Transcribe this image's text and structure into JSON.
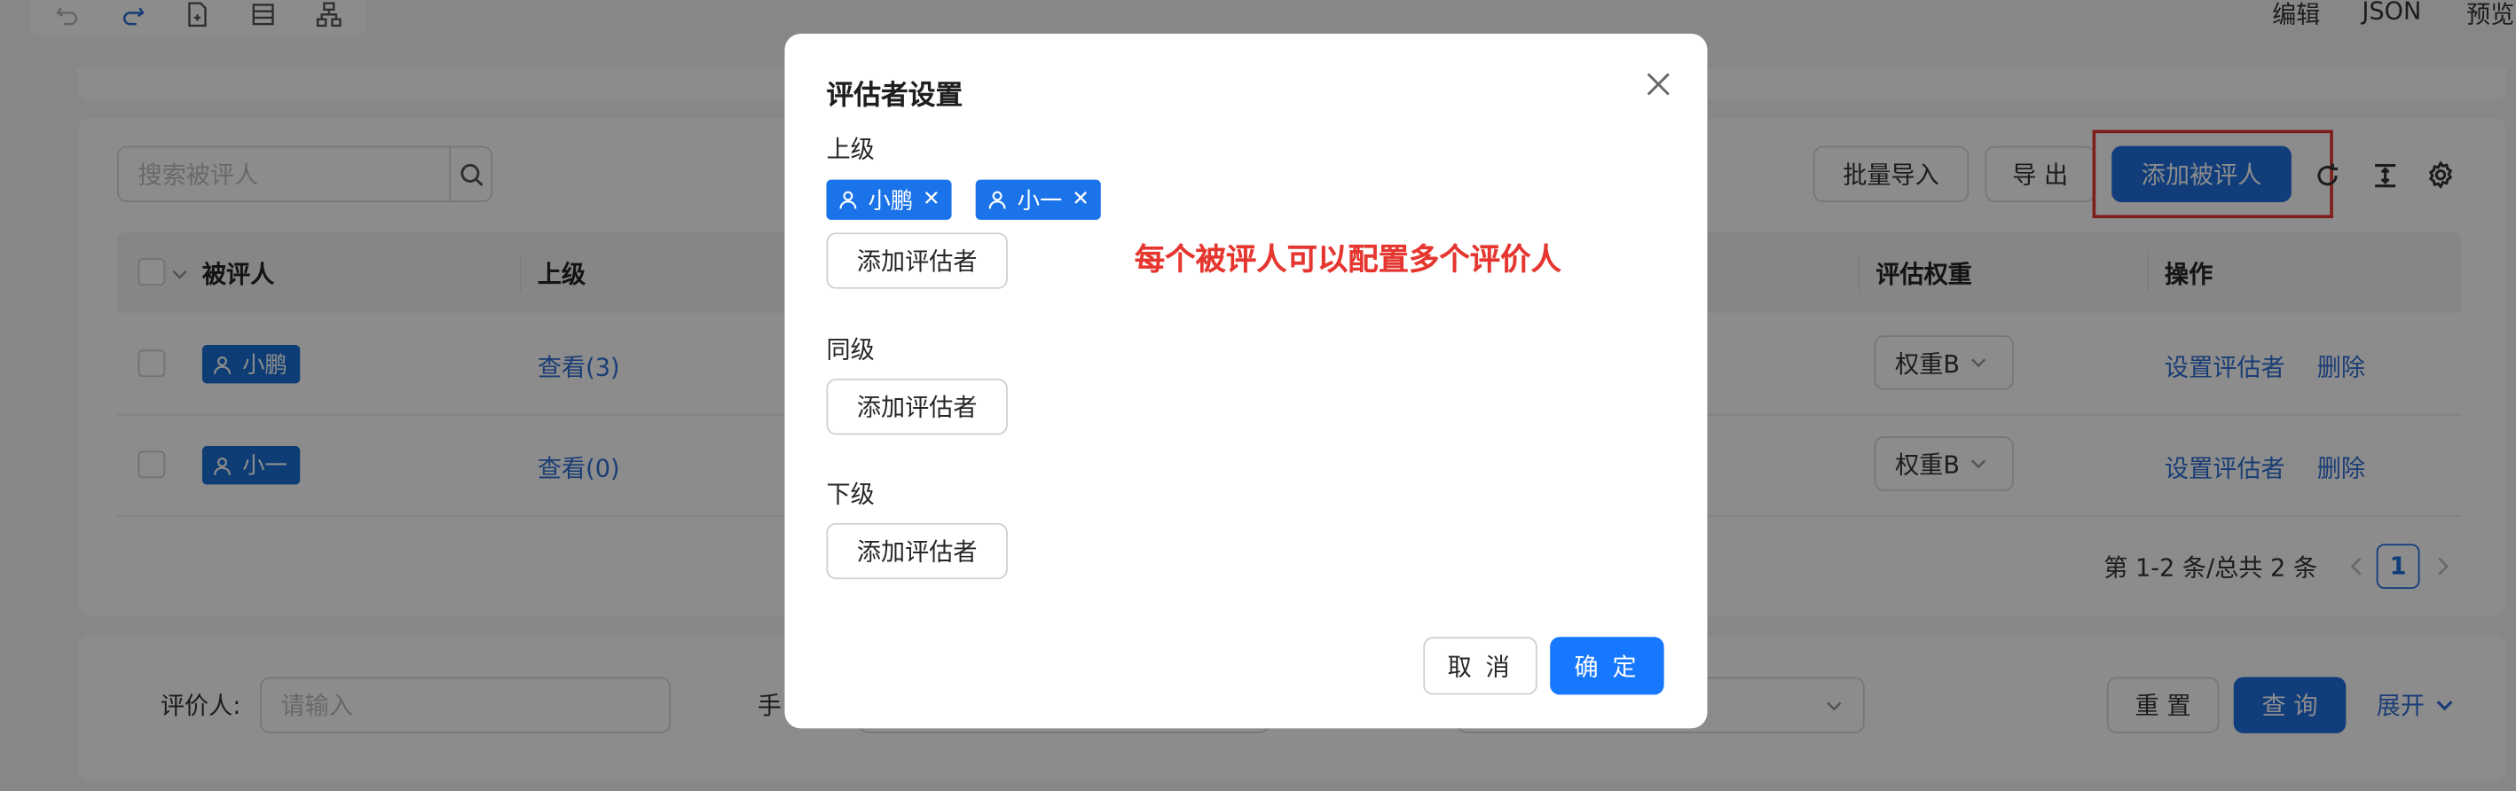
{
  "toolbar": {
    "icons": [
      "undo-icon",
      "redo-icon",
      "document-add-icon",
      "table-icon",
      "tree-icon"
    ],
    "right_links": [
      "编辑",
      "JSON",
      "预览"
    ]
  },
  "search": {
    "placeholder": "搜索被评人"
  },
  "actions": {
    "batch_import": "批量导入",
    "export": "导 出",
    "add_evaluatee": "添加被评人"
  },
  "table": {
    "columns": [
      "被评人",
      "上级",
      "评估权重",
      "操作"
    ],
    "rows": [
      {
        "name": "小鹏",
        "superior": "查看(3)",
        "weight": "权重B",
        "set": "设置评估者",
        "delete": "删除"
      },
      {
        "name": "小一",
        "superior": "查看(0)",
        "weight": "权重B",
        "set": "设置评估者",
        "delete": "删除"
      }
    ]
  },
  "pagination": {
    "summary": "第 1-2 条/总共 2 条",
    "current": "1"
  },
  "filter": {
    "evaluator_label": "评价人:",
    "evaluator_placeholder": "请输入",
    "second_label": "手",
    "reset": "重 置",
    "query": "查 询",
    "expand": "展开"
  },
  "modal": {
    "title": "评估者设置",
    "sections": [
      {
        "label": "上级",
        "tags": [
          "小鹏",
          "小一"
        ],
        "add": "添加评估者"
      },
      {
        "label": "同级",
        "tags": [],
        "add": "添加评估者"
      },
      {
        "label": "下级",
        "tags": [],
        "add": "添加评估者"
      }
    ],
    "cancel": "取 消",
    "confirm": "确 定"
  },
  "annotation": {
    "text": "每个被评人可以配置多个评价人",
    "color": "#e5362f"
  },
  "colors": {
    "primary": "#1f6fe0",
    "tag": "#1a73e8",
    "annotation": "#e5362f"
  }
}
